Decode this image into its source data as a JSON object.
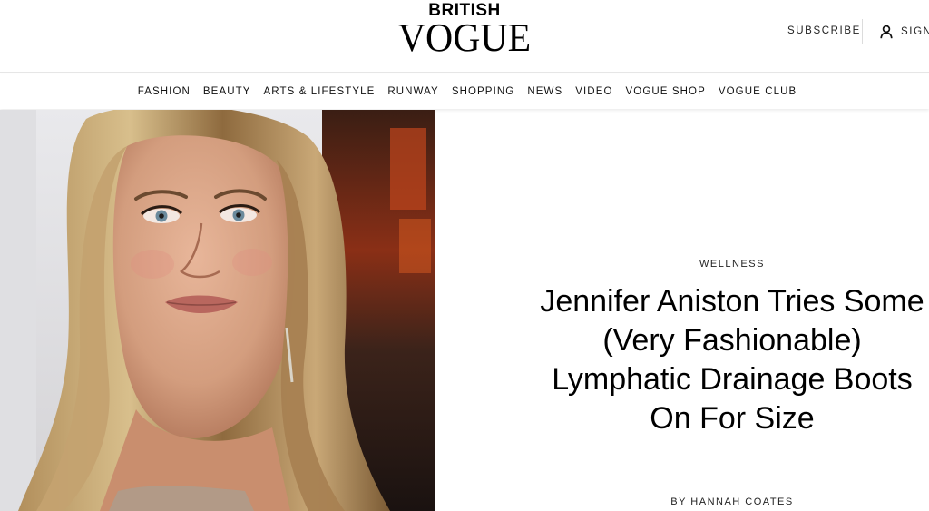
{
  "header": {
    "logo_top": "BRITISH",
    "logo_main": "VOGUE",
    "subscribe_label": "SUBSCRIBE",
    "signin_label": "SIGN IN",
    "user_icon": "user-icon"
  },
  "nav": {
    "items": [
      {
        "label": "FASHION"
      },
      {
        "label": "BEAUTY"
      },
      {
        "label": "ARTS & LIFESTYLE"
      },
      {
        "label": "RUNWAY"
      },
      {
        "label": "SHOPPING"
      },
      {
        "label": "NEWS"
      },
      {
        "label": "VIDEO"
      },
      {
        "label": "VOGUE SHOP"
      },
      {
        "label": "VOGUE CLUB"
      }
    ]
  },
  "article": {
    "rubric": "WELLNESS",
    "headline": "Jennifer Aniston Tries Some (Very Fashionable) Lymphatic Drainage Boots On For Size",
    "byline": "BY HANNAH COATES"
  },
  "colors": {
    "background": "#ffffff",
    "text": "#000000",
    "divider": "#e6e6e6"
  }
}
